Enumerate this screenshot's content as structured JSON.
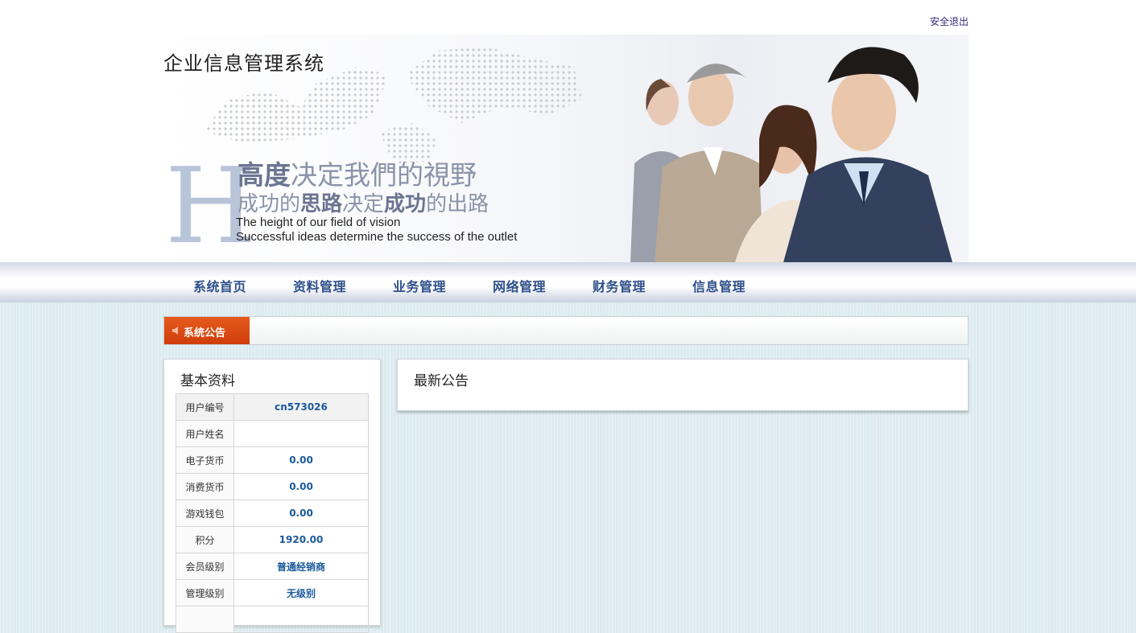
{
  "header": {
    "logout_label": "安全退出",
    "site_title": "企业信息管理系统",
    "banner": {
      "big_letter": "H",
      "slogan_line1_a": "高度",
      "slogan_line1_b": "决定我們的視野",
      "slogan_line2_a": "成功的",
      "slogan_line2_b": "思路",
      "slogan_line2_c": "决定",
      "slogan_line2_d": "成功",
      "slogan_line2_e": "的出路",
      "slogan_en_line1": "The height of our field of vision",
      "slogan_en_line2": "Successful ideas determine the success of the outlet"
    }
  },
  "nav": {
    "items": [
      {
        "label": "系统首页"
      },
      {
        "label": "资料管理"
      },
      {
        "label": "业务管理"
      },
      {
        "label": "网络管理"
      },
      {
        "label": "财务管理"
      },
      {
        "label": "信息管理"
      }
    ]
  },
  "notice": {
    "tag_label": "系统公告",
    "icon": "speaker-icon",
    "text": ""
  },
  "basic_info": {
    "title": "基本资料",
    "rows": [
      {
        "key": "用户编号",
        "value": "cn573026"
      },
      {
        "key": "用户姓名",
        "value": ""
      },
      {
        "key": "电子货币",
        "value": "0.00"
      },
      {
        "key": "消费货币",
        "value": "0.00"
      },
      {
        "key": "游戏钱包",
        "value": "0.00"
      },
      {
        "key": "积分",
        "value": "1920.00"
      },
      {
        "key": "会员级别",
        "value": "普通经销商"
      },
      {
        "key": "管理级别",
        "value": "无级别"
      },
      {
        "key": "",
        "value": ""
      }
    ]
  },
  "latest_notice": {
    "title": "最新公告"
  },
  "colors": {
    "accent_orange": "#e04e12",
    "nav_text": "#2f4f8a",
    "value_blue": "#1b5a9c",
    "page_bg": "#dcebf0"
  }
}
